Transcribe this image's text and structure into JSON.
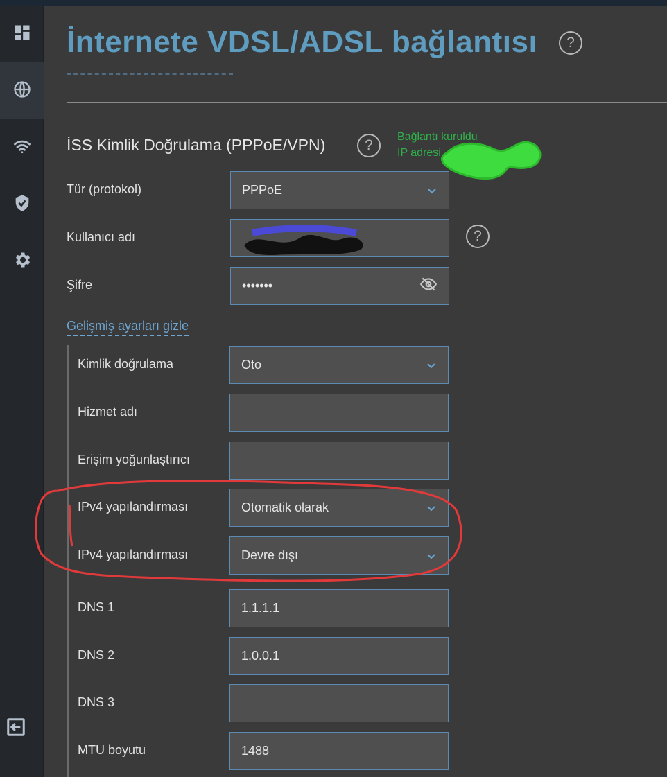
{
  "page": {
    "title": "İnternete VDSL/ADSL bağlantısı",
    "help_glyph": "?"
  },
  "sidebar": {
    "items": [
      {
        "icon": "dashboard-icon",
        "active": false
      },
      {
        "icon": "globe-icon",
        "active": true
      },
      {
        "icon": "wifi-icon",
        "active": false
      },
      {
        "icon": "shield-icon",
        "active": false
      },
      {
        "icon": "gear-icon",
        "active": false
      }
    ],
    "logout_icon": "logout-icon"
  },
  "isp": {
    "section_title": "İSS Kimlik Doğrulama (PPPoE/VPN)",
    "status_line1": "Bağlantı kuruldu",
    "status_line2": "IP adresi",
    "protocol_label": "Tür (protokol)",
    "protocol_value": "PPPoE",
    "username_label": "Kullanıcı adı",
    "username_value": "",
    "password_label": "Şifre",
    "password_value": "•••••••",
    "advanced_link": "Gelişmiş ayarları gizle"
  },
  "advanced": {
    "auth_label": "Kimlik doğrulama",
    "auth_value": "Oto",
    "service_label": "Hizmet adı",
    "service_value": "",
    "concentrator_label": "Erişim yoğunlaştırıcı",
    "concentrator_value": "",
    "ipv4_label": "IPv4 yapılandırması",
    "ipv4_value": "Otomatik olarak",
    "ipv6_label": "IPv4 yapılandırması",
    "ipv6_value": "Devre dışı",
    "dns1_label": "DNS 1",
    "dns1_value": "1.1.1.1",
    "dns2_label": "DNS 2",
    "dns2_value": "1.0.0.1",
    "dns3_label": "DNS 3",
    "dns3_value": "",
    "mtu_label": "MTU boyutu",
    "mtu_value": "1488"
  },
  "colors": {
    "accent": "#5f9dc0",
    "status_green": "#2fb24a",
    "annotation_red": "#e23a3a"
  }
}
